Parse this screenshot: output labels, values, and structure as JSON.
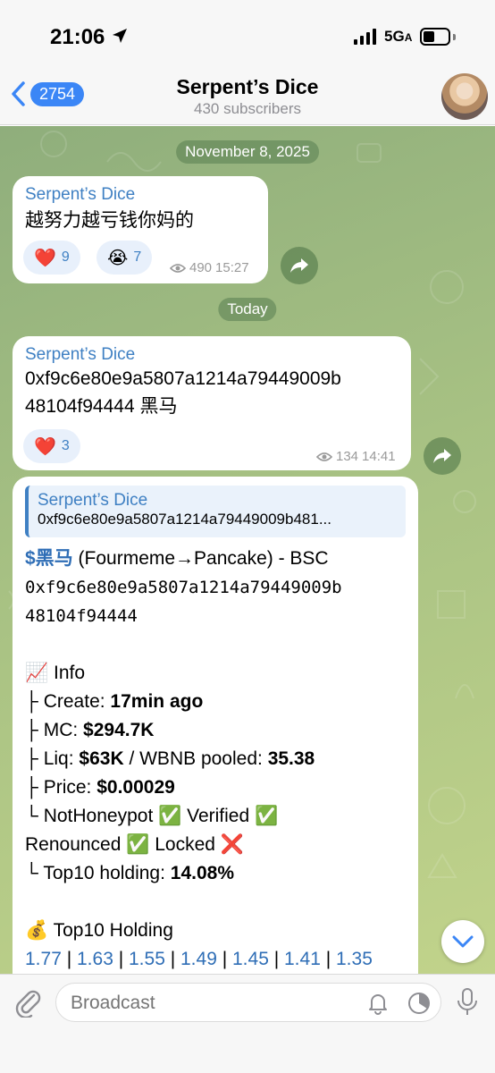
{
  "status_bar": {
    "time": "21:06",
    "network": "5G",
    "network_suffix": "A"
  },
  "header": {
    "back_count": "2754",
    "title": "Serpent’s Dice",
    "subtitle": "430 subscribers"
  },
  "chat": {
    "date_1": "November 8, 2025",
    "msg1": {
      "sender": "Serpent’s Dice",
      "text": "越努力越亏钱你妈的",
      "reactions": [
        {
          "emoji": "❤️",
          "count": "9"
        },
        {
          "emoji": "😭",
          "count": "7"
        }
      ],
      "views": "490",
      "time": "15:27"
    },
    "date_2": "Today",
    "msg2": {
      "sender": "Serpent’s Dice",
      "text_line1": "0xf9c6e80e9a5807a1214a79449009b",
      "text_line2": "48104f94444 黑马",
      "reactions": [
        {
          "emoji": "❤️",
          "count": "3"
        }
      ],
      "views": "134",
      "time": "14:41"
    },
    "msg3": {
      "reply_sender": "Serpent’s Dice",
      "reply_text": "0xf9c6e80e9a5807a1214a79449009b481...",
      "ticker": "$黑马",
      "route": " (Fourmeme→Pancake) - BSC",
      "addr_line1": "0xf9c6e80e9a5807a1214a79449009b",
      "addr_line2": "48104f94444",
      "info_header": "📈 Info",
      "create_label": " ├ Create: ",
      "create_value": "17min ago",
      "mc_label": " ├ MC: ",
      "mc_value": "$294.7K",
      "liq_label": " ├ Liq: ",
      "liq_value": "$63K",
      "liq_sep": " / WBNB pooled: ",
      "liq_pooled": "35.38",
      "price_label": " ├ Price: ",
      "price_value": "$0.00029",
      "checks_line1": " └ NotHoneypot ✅ Verified ✅",
      "checks_line2": "Renounced ✅ Locked ❌",
      "top10_label": " └ Top10 holding: ",
      "top10_value": "14.08%",
      "holding_header": "💰 Top10 Holding",
      "holdings": [
        "1.77",
        "1.63",
        "1.55",
        "1.49",
        "1.45",
        "1.41",
        "1.35"
      ]
    }
  },
  "bottom": {
    "placeholder": "Broadcast"
  }
}
